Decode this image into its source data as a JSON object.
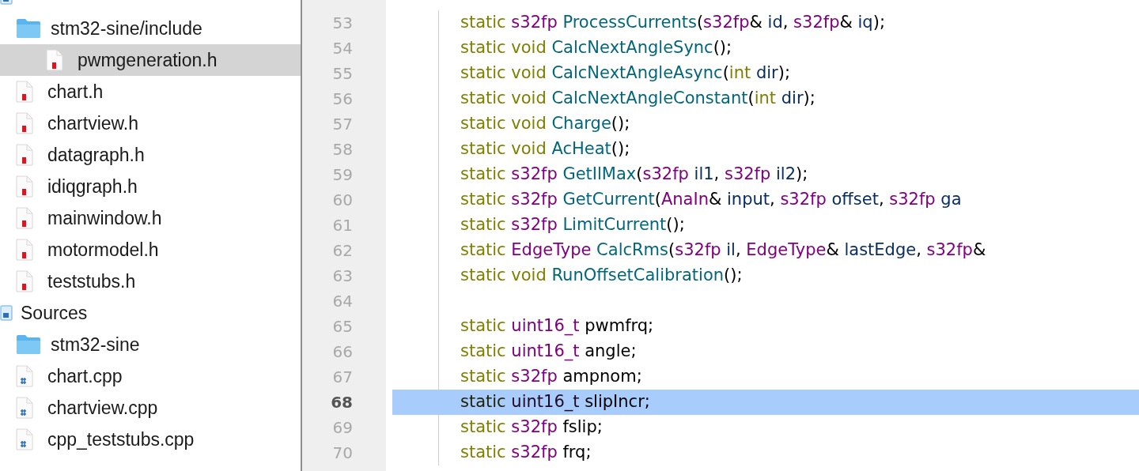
{
  "sidebar": {
    "items": [
      {
        "kind": "group",
        "selected": false,
        "children": [
          {
            "kind": "folder",
            "label": "stm32-sine/include",
            "selected": false,
            "children": [
              {
                "kind": "header",
                "label": "pwmgeneration.h",
                "selected": true
              }
            ]
          },
          {
            "kind": "header",
            "label": "chart.h",
            "selected": false
          },
          {
            "kind": "header",
            "label": "chartview.h",
            "selected": false
          },
          {
            "kind": "header",
            "label": "datagraph.h",
            "selected": false
          },
          {
            "kind": "header",
            "label": "idiqgraph.h",
            "selected": false
          },
          {
            "kind": "header",
            "label": "mainwindow.h",
            "selected": false
          },
          {
            "kind": "header",
            "label": "motormodel.h",
            "selected": false
          },
          {
            "kind": "header",
            "label": "teststubs.h",
            "selected": false
          }
        ]
      },
      {
        "kind": "group",
        "label": "Sources",
        "selected": false,
        "children": [
          {
            "kind": "folder",
            "label": "stm32-sine",
            "selected": false
          },
          {
            "kind": "source",
            "label": "chart.cpp",
            "selected": false
          },
          {
            "kind": "source",
            "label": "chartview.cpp",
            "selected": false
          },
          {
            "kind": "source",
            "label": "cpp_teststubs.cpp",
            "selected": false
          }
        ]
      }
    ]
  },
  "editor": {
    "lines": [
      {
        "number": "53",
        "selected": false,
        "tokens": [
          {
            "kind": "keyword",
            "text": "static "
          },
          {
            "kind": "type",
            "text": "s32fp "
          },
          {
            "kind": "function",
            "text": "ProcessCurrents"
          },
          {
            "kind": "plain",
            "text": "("
          },
          {
            "kind": "type",
            "text": "s32fp"
          },
          {
            "kind": "plain",
            "text": "& "
          },
          {
            "kind": "param",
            "text": "id"
          },
          {
            "kind": "plain",
            "text": ", "
          },
          {
            "kind": "type",
            "text": "s32fp"
          },
          {
            "kind": "plain",
            "text": "& "
          },
          {
            "kind": "param",
            "text": "iq"
          },
          {
            "kind": "plain",
            "text": ");"
          }
        ]
      },
      {
        "number": "54",
        "selected": false,
        "tokens": [
          {
            "kind": "keyword",
            "text": "static void "
          },
          {
            "kind": "function",
            "text": "CalcNextAngleSync"
          },
          {
            "kind": "plain",
            "text": "();"
          }
        ]
      },
      {
        "number": "55",
        "selected": false,
        "tokens": [
          {
            "kind": "keyword",
            "text": "static void "
          },
          {
            "kind": "function",
            "text": "CalcNextAngleAsync"
          },
          {
            "kind": "plain",
            "text": "("
          },
          {
            "kind": "keyword",
            "text": "int "
          },
          {
            "kind": "param",
            "text": "dir"
          },
          {
            "kind": "plain",
            "text": ");"
          }
        ]
      },
      {
        "number": "56",
        "selected": false,
        "tokens": [
          {
            "kind": "keyword",
            "text": "static void "
          },
          {
            "kind": "function",
            "text": "CalcNextAngleConstant"
          },
          {
            "kind": "plain",
            "text": "("
          },
          {
            "kind": "keyword",
            "text": "int "
          },
          {
            "kind": "param",
            "text": "dir"
          },
          {
            "kind": "plain",
            "text": ");"
          }
        ]
      },
      {
        "number": "57",
        "selected": false,
        "tokens": [
          {
            "kind": "keyword",
            "text": "static void "
          },
          {
            "kind": "function",
            "text": "Charge"
          },
          {
            "kind": "plain",
            "text": "();"
          }
        ]
      },
      {
        "number": "58",
        "selected": false,
        "tokens": [
          {
            "kind": "keyword",
            "text": "static void "
          },
          {
            "kind": "function",
            "text": "AcHeat"
          },
          {
            "kind": "plain",
            "text": "();"
          }
        ]
      },
      {
        "number": "59",
        "selected": false,
        "tokens": [
          {
            "kind": "keyword",
            "text": "static "
          },
          {
            "kind": "type",
            "text": "s32fp "
          },
          {
            "kind": "function",
            "text": "GetIlMax"
          },
          {
            "kind": "plain",
            "text": "("
          },
          {
            "kind": "type",
            "text": "s32fp "
          },
          {
            "kind": "param",
            "text": "il1"
          },
          {
            "kind": "plain",
            "text": ", "
          },
          {
            "kind": "type",
            "text": "s32fp "
          },
          {
            "kind": "param",
            "text": "il2"
          },
          {
            "kind": "plain",
            "text": ");"
          }
        ]
      },
      {
        "number": "60",
        "selected": false,
        "tokens": [
          {
            "kind": "keyword",
            "text": "static "
          },
          {
            "kind": "type",
            "text": "s32fp "
          },
          {
            "kind": "function",
            "text": "GetCurrent"
          },
          {
            "kind": "plain",
            "text": "("
          },
          {
            "kind": "type",
            "text": "AnaIn"
          },
          {
            "kind": "plain",
            "text": "& "
          },
          {
            "kind": "param",
            "text": "input"
          },
          {
            "kind": "plain",
            "text": ", "
          },
          {
            "kind": "type",
            "text": "s32fp "
          },
          {
            "kind": "param",
            "text": "offset"
          },
          {
            "kind": "plain",
            "text": ", "
          },
          {
            "kind": "type",
            "text": "s32fp "
          },
          {
            "kind": "param",
            "text": "ga"
          }
        ]
      },
      {
        "number": "61",
        "selected": false,
        "tokens": [
          {
            "kind": "keyword",
            "text": "static "
          },
          {
            "kind": "type",
            "text": "s32fp "
          },
          {
            "kind": "function",
            "text": "LimitCurrent"
          },
          {
            "kind": "plain",
            "text": "();"
          }
        ]
      },
      {
        "number": "62",
        "selected": false,
        "tokens": [
          {
            "kind": "keyword",
            "text": "static "
          },
          {
            "kind": "type",
            "text": "EdgeType "
          },
          {
            "kind": "function",
            "text": "CalcRms"
          },
          {
            "kind": "plain",
            "text": "("
          },
          {
            "kind": "type",
            "text": "s32fp "
          },
          {
            "kind": "param",
            "text": "il"
          },
          {
            "kind": "plain",
            "text": ", "
          },
          {
            "kind": "type",
            "text": "EdgeType"
          },
          {
            "kind": "plain",
            "text": "& "
          },
          {
            "kind": "param",
            "text": "lastEdge"
          },
          {
            "kind": "plain",
            "text": ", "
          },
          {
            "kind": "type",
            "text": "s32fp"
          },
          {
            "kind": "plain",
            "text": "&"
          }
        ]
      },
      {
        "number": "63",
        "selected": false,
        "tokens": [
          {
            "kind": "keyword",
            "text": "static void "
          },
          {
            "kind": "function",
            "text": "RunOffsetCalibration"
          },
          {
            "kind": "plain",
            "text": "();"
          }
        ]
      },
      {
        "number": "64",
        "selected": false
      },
      {
        "number": "65",
        "selected": false,
        "tokens": [
          {
            "kind": "keyword",
            "text": "static "
          },
          {
            "kind": "type",
            "text": "uint16_t "
          },
          {
            "kind": "plain",
            "text": "pwmfrq;"
          }
        ]
      },
      {
        "number": "66",
        "selected": false,
        "tokens": [
          {
            "kind": "keyword",
            "text": "static "
          },
          {
            "kind": "type",
            "text": "uint16_t "
          },
          {
            "kind": "plain",
            "text": "angle;"
          }
        ]
      },
      {
        "number": "67",
        "selected": false,
        "tokens": [
          {
            "kind": "keyword",
            "text": "static "
          },
          {
            "kind": "type",
            "text": "s32fp "
          },
          {
            "kind": "plain",
            "text": "ampnom;"
          }
        ]
      },
      {
        "number": "68",
        "selected": true,
        "tokens": [
          {
            "kind": "keyword",
            "text": "static "
          },
          {
            "kind": "type",
            "text": "uint16_t "
          },
          {
            "kind": "plain",
            "text": "slipIncr;"
          }
        ]
      },
      {
        "number": "69",
        "selected": false,
        "tokens": [
          {
            "kind": "keyword",
            "text": "static "
          },
          {
            "kind": "type",
            "text": "s32fp "
          },
          {
            "kind": "plain",
            "text": "fslip;"
          }
        ]
      },
      {
        "number": "70",
        "selected": false,
        "tokens": [
          {
            "kind": "keyword",
            "text": "static "
          },
          {
            "kind": "type",
            "text": "s32fp "
          },
          {
            "kind": "plain",
            "text": "frq;"
          }
        ]
      }
    ]
  }
}
